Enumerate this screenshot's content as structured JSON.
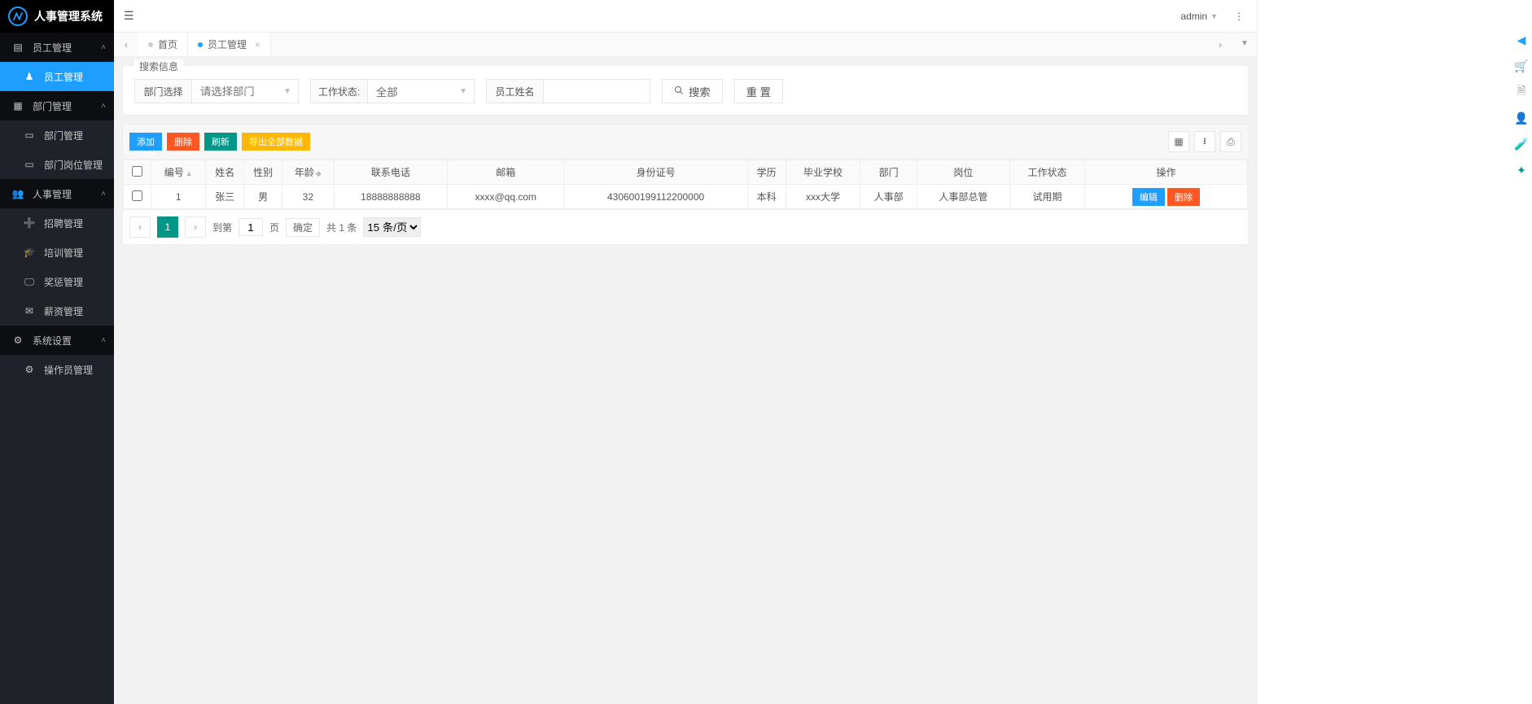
{
  "app": {
    "title": "人事管理系统",
    "user": "admin"
  },
  "sidebar": {
    "groups": [
      {
        "label": "员工管理",
        "icon": "file",
        "children": [
          {
            "label": "员工管理",
            "icon": "user",
            "active": true
          }
        ]
      },
      {
        "label": "部门管理",
        "icon": "grid",
        "children": [
          {
            "label": "部门管理",
            "icon": "id-card"
          },
          {
            "label": "部门岗位管理",
            "icon": "id-card"
          }
        ]
      },
      {
        "label": "人事管理",
        "icon": "people",
        "children": [
          {
            "label": "招聘管理",
            "icon": "add-user"
          },
          {
            "label": "培训管理",
            "icon": "grad-cap"
          },
          {
            "label": "奖惩管理",
            "icon": "monitor"
          },
          {
            "label": "薪资管理",
            "icon": "mail"
          }
        ]
      },
      {
        "label": "系统设置",
        "icon": "gears",
        "children": [
          {
            "label": "操作员管理",
            "icon": "gears"
          }
        ]
      }
    ]
  },
  "tabs": {
    "items": [
      {
        "label": "首页",
        "closable": false,
        "active": false
      },
      {
        "label": "员工管理",
        "closable": true,
        "active": true
      }
    ]
  },
  "search": {
    "legend": "搜索信息",
    "dept_label": "部门选择",
    "dept_placeholder": "请选择部门",
    "status_label": "工作状态:",
    "status_value": "全部",
    "name_label": "员工姓名",
    "search_btn": "搜索",
    "reset_btn": "重 置"
  },
  "toolbar": {
    "add": "添加",
    "delete": "删除",
    "refresh": "刷新",
    "export": "导出全部数据"
  },
  "table": {
    "headers": {
      "id": "编号",
      "name": "姓名",
      "gender": "性别",
      "age": "年龄",
      "phone": "联系电话",
      "email": "邮箱",
      "idcard": "身份证号",
      "edu": "学历",
      "school": "毕业学校",
      "dept": "部门",
      "post": "岗位",
      "status": "工作状态",
      "action": "操作"
    },
    "rows": [
      {
        "id": "1",
        "name": "张三",
        "gender": "男",
        "age": "32",
        "phone": "18888888888",
        "email": "xxxx@qq.com",
        "idcard": "430600199112200000",
        "edu": "本科",
        "school": "xxx大学",
        "dept": "人事部",
        "post": "人事部总管",
        "status": "试用期"
      }
    ],
    "row_actions": {
      "edit": "编辑",
      "delete": "删除"
    }
  },
  "pager": {
    "goto_label": "到第",
    "page_value": "1",
    "page_unit": "页",
    "confirm": "确定",
    "total_label": "共 1 条",
    "per_page": "15 条/页"
  }
}
